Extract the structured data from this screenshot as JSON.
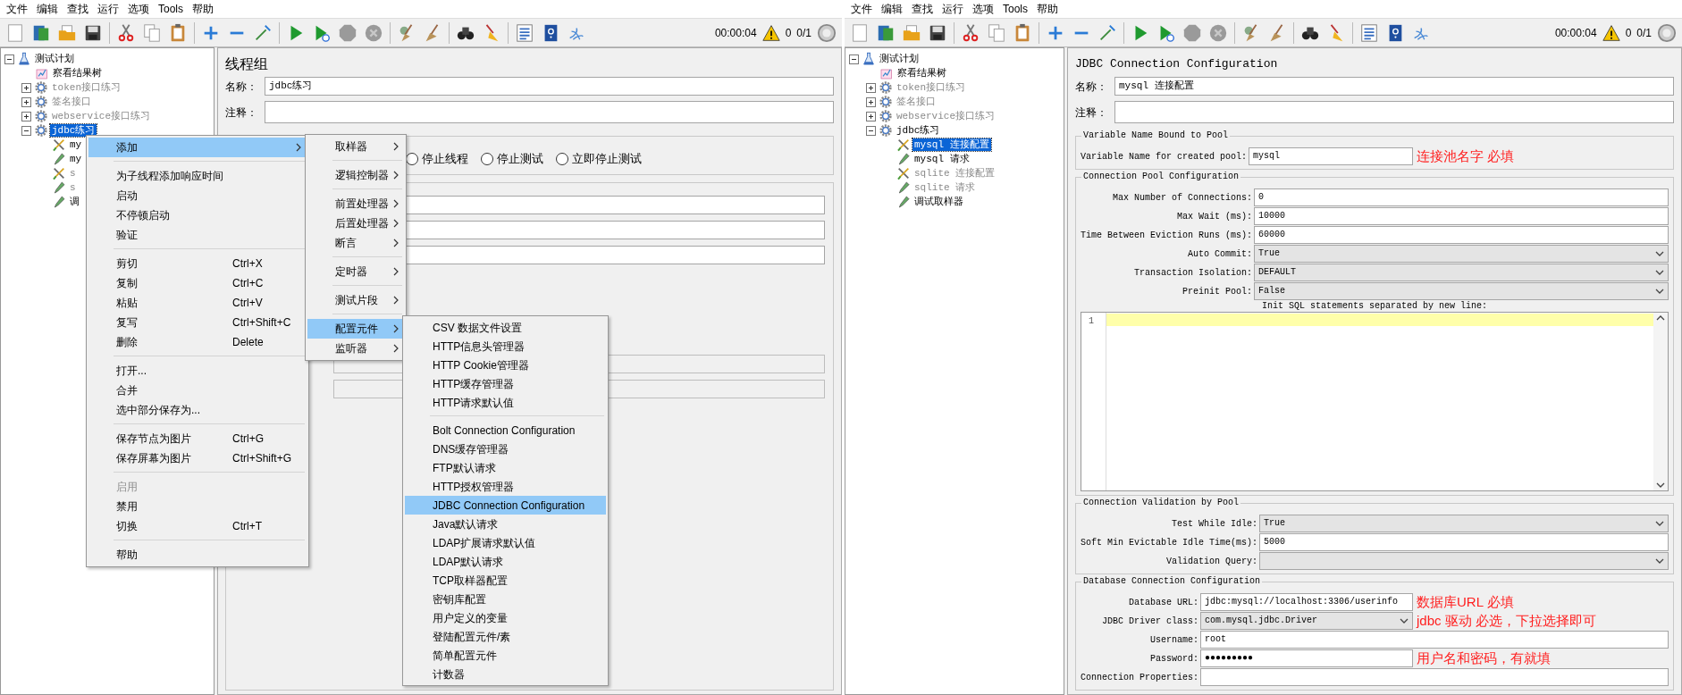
{
  "windows": [
    {
      "menubar": [
        "文件",
        "编辑",
        "查找",
        "运行",
        "选项",
        "Tools",
        "帮助"
      ],
      "status": {
        "timer": "00:00:04",
        "warnings": "0",
        "threads": "0/1"
      },
      "tree": [
        {
          "label": "测试计划",
          "kind": "plan",
          "expanded": true,
          "selected": false,
          "disabled": false,
          "children": [
            {
              "label": "察看结果树",
              "kind": "listener",
              "selected": false,
              "disabled": false
            },
            {
              "label": "token接口练习",
              "kind": "thread-group",
              "expanded": false,
              "selected": false,
              "disabled": true
            },
            {
              "label": "签名接口",
              "kind": "thread-group",
              "expanded": false,
              "selected": false,
              "disabled": true
            },
            {
              "label": "webservice接口练习",
              "kind": "thread-group",
              "expanded": false,
              "selected": false,
              "disabled": true
            },
            {
              "label": "jdbc练习",
              "kind": "thread-group",
              "expanded": true,
              "selected": true,
              "disabled": false,
              "children": [
                {
                  "label": "my",
                  "kind": "config",
                  "selected": false,
                  "disabled": false
                },
                {
                  "label": "my",
                  "kind": "sampler",
                  "selected": false,
                  "disabled": false
                },
                {
                  "label": "s",
                  "kind": "config",
                  "selected": false,
                  "disabled": true
                },
                {
                  "label": "s",
                  "kind": "sampler",
                  "selected": false,
                  "disabled": true
                },
                {
                  "label": "调",
                  "kind": "sampler",
                  "selected": false,
                  "disabled": false
                }
              ]
            }
          ]
        }
      ],
      "panel": {
        "kind": "thread-group",
        "title": "线程组",
        "name_label": "名称：",
        "name_value": "jdbc练习",
        "comment_label": "注释：",
        "radios": [
          {
            "label": "停止线程",
            "selected": false
          },
          {
            "label": "停止测试",
            "selected": false
          },
          {
            "label": "立即停止测试",
            "selected": false
          }
        ],
        "fields": [
          {
            "disabled": false
          },
          {
            "disabled": false
          },
          {
            "disabled": false
          },
          {
            "disabled": true
          },
          {
            "disabled": true
          }
        ]
      },
      "context_menu": {
        "groups": [
          [
            {
              "label": "添加",
              "has_submenu": true,
              "selected": true,
              "disabled": false,
              "submenu": {
                "groups": [
                  [
                    {
                      "label": "取样器",
                      "has_submenu": true,
                      "selected": false
                    }
                  ],
                  [
                    {
                      "label": "逻辑控制器",
                      "has_submenu": true,
                      "selected": false
                    }
                  ],
                  [
                    {
                      "label": "前置处理器",
                      "has_submenu": true,
                      "selected": false
                    },
                    {
                      "label": "后置处理器",
                      "has_submenu": true,
                      "selected": false
                    },
                    {
                      "label": "断言",
                      "has_submenu": true,
                      "selected": false
                    }
                  ],
                  [
                    {
                      "label": "定时器",
                      "has_submenu": true,
                      "selected": false
                    }
                  ],
                  [
                    {
                      "label": "测试片段",
                      "has_submenu": true,
                      "selected": false
                    }
                  ],
                  [
                    {
                      "label": "配置元件",
                      "has_submenu": true,
                      "selected": true,
                      "submenu": {
                        "groups": [
                          [
                            {
                              "label": "CSV 数据文件设置",
                              "selected": false
                            },
                            {
                              "label": "HTTP信息头管理器",
                              "selected": false
                            },
                            {
                              "label": "HTTP Cookie管理器",
                              "selected": false
                            },
                            {
                              "label": "HTTP缓存管理器",
                              "selected": false
                            },
                            {
                              "label": "HTTP请求默认值",
                              "selected": false
                            }
                          ],
                          [
                            {
                              "label": "Bolt Connection Configuration",
                              "selected": false
                            },
                            {
                              "label": "DNS缓存管理器",
                              "selected": false
                            },
                            {
                              "label": "FTP默认请求",
                              "selected": false
                            },
                            {
                              "label": "HTTP授权管理器",
                              "selected": false
                            },
                            {
                              "label": "JDBC Connection Configuration",
                              "selected": true
                            },
                            {
                              "label": "Java默认请求",
                              "selected": false
                            },
                            {
                              "label": "LDAP扩展请求默认值",
                              "selected": false
                            },
                            {
                              "label": "LDAP默认请求",
                              "selected": false
                            },
                            {
                              "label": "TCP取样器配置",
                              "selected": false
                            },
                            {
                              "label": "密钥库配置",
                              "selected": false
                            },
                            {
                              "label": "用户定义的变量",
                              "selected": false
                            },
                            {
                              "label": "登陆配置元件/素",
                              "selected": false
                            },
                            {
                              "label": "简单配置元件",
                              "selected": false
                            },
                            {
                              "label": "计数器",
                              "selected": false
                            }
                          ]
                        ]
                      }
                    },
                    {
                      "label": "监听器",
                      "has_submenu": true,
                      "selected": false
                    }
                  ]
                ]
              }
            }
          ],
          [
            {
              "label": "为子线程添加响应时间",
              "has_submenu": false,
              "selected": false,
              "disabled": false
            },
            {
              "label": "启动",
              "has_submenu": false,
              "selected": false,
              "disabled": false
            },
            {
              "label": "不停顿启动",
              "has_submenu": false,
              "selected": false,
              "disabled": false
            },
            {
              "label": "验证",
              "has_submenu": false,
              "selected": false,
              "disabled": false
            }
          ],
          [
            {
              "label": "剪切",
              "shortcut": "Ctrl+X",
              "has_submenu": false,
              "selected": false,
              "disabled": false
            },
            {
              "label": "复制",
              "shortcut": "Ctrl+C",
              "has_submenu": false,
              "selected": false,
              "disabled": false
            },
            {
              "label": "粘贴",
              "shortcut": "Ctrl+V",
              "has_submenu": false,
              "selected": false,
              "disabled": false
            },
            {
              "label": "复写",
              "shortcut": "Ctrl+Shift+C",
              "has_submenu": false,
              "selected": false,
              "disabled": false
            },
            {
              "label": "删除",
              "shortcut": "Delete",
              "has_submenu": false,
              "selected": false,
              "disabled": false
            }
          ],
          [
            {
              "label": "打开...",
              "has_submenu": false,
              "selected": false,
              "disabled": false
            },
            {
              "label": "合并",
              "has_submenu": false,
              "selected": false,
              "disabled": false
            },
            {
              "label": "选中部分保存为...",
              "has_submenu": false,
              "selected": false,
              "disabled": false
            }
          ],
          [
            {
              "label": "保存节点为图片",
              "shortcut": "Ctrl+G",
              "has_submenu": false,
              "selected": false,
              "disabled": false
            },
            {
              "label": "保存屏幕为图片",
              "shortcut": "Ctrl+Shift+G",
              "has_submenu": false,
              "selected": false,
              "disabled": false
            }
          ],
          [
            {
              "label": "启用",
              "has_submenu": false,
              "selected": false,
              "disabled": true
            },
            {
              "label": "禁用",
              "has_submenu": false,
              "selected": false,
              "disabled": false
            },
            {
              "label": "切换",
              "shortcut": "Ctrl+T",
              "has_submenu": false,
              "selected": false,
              "disabled": false
            }
          ],
          [
            {
              "label": "帮助",
              "has_submenu": false,
              "selected": false,
              "disabled": false
            }
          ]
        ]
      }
    },
    {
      "menubar": [
        "文件",
        "编辑",
        "查找",
        "运行",
        "选项",
        "Tools",
        "帮助"
      ],
      "status": {
        "timer": "00:00:04",
        "warnings": "0",
        "threads": "0/1"
      },
      "tree": [
        {
          "label": "测试计划",
          "kind": "plan",
          "expanded": true,
          "selected": false,
          "disabled": false,
          "children": [
            {
              "label": "察看结果树",
              "kind": "listener",
              "selected": false,
              "disabled": false
            },
            {
              "label": "token接口练习",
              "kind": "thread-group",
              "expanded": false,
              "selected": false,
              "disabled": true
            },
            {
              "label": "签名接口",
              "kind": "thread-group",
              "expanded": false,
              "selected": false,
              "disabled": true
            },
            {
              "label": "webservice接口练习",
              "kind": "thread-group",
              "expanded": false,
              "selected": false,
              "disabled": true
            },
            {
              "label": "jdbc练习",
              "kind": "thread-group",
              "expanded": true,
              "selected": false,
              "disabled": false,
              "children": [
                {
                  "label": "mysql 连接配置",
                  "kind": "config",
                  "selected": true,
                  "disabled": false
                },
                {
                  "label": "mysql 请求",
                  "kind": "sampler",
                  "selected": false,
                  "disabled": false
                },
                {
                  "label": "sqlite 连接配置",
                  "kind": "config",
                  "selected": false,
                  "disabled": true
                },
                {
                  "label": "sqlite 请求",
                  "kind": "sampler",
                  "selected": false,
                  "disabled": true
                },
                {
                  "label": "调试取样器",
                  "kind": "sampler",
                  "selected": false,
                  "disabled": false
                }
              ]
            }
          ]
        }
      ],
      "panel": {
        "kind": "jdbc-config",
        "title": "JDBC Connection Configuration",
        "name_label": "名称：",
        "name_value": "mysql 连接配置",
        "comment_label": "注释：",
        "sections": [
          {
            "legend": "Variable Name Bound to Pool",
            "rows": [
              {
                "label": "Variable Name for created pool:",
                "kind": "text",
                "value": "mysql",
                "note": "连接池名字 必填"
              }
            ]
          },
          {
            "legend": "Connection Pool Configuration",
            "rows": [
              {
                "label": "Max Number of Connections:",
                "kind": "text",
                "value": "0"
              },
              {
                "label": "Max Wait (ms):",
                "kind": "text",
                "value": "10000"
              },
              {
                "label": "Time Between Eviction Runs (ms):",
                "kind": "text",
                "value": "60000"
              },
              {
                "label": "Auto Commit:",
                "kind": "select",
                "value": "True"
              },
              {
                "label": "Transaction Isolation:",
                "kind": "select",
                "value": "DEFAULT"
              },
              {
                "label": "Preinit Pool:",
                "kind": "select",
                "value": "False"
              }
            ],
            "editor": {
              "label": "Init SQL statements separated by new line:",
              "line_number": "1"
            }
          },
          {
            "legend": "Connection Validation by Pool",
            "rows": [
              {
                "label": "Test While Idle:",
                "kind": "select",
                "value": "True"
              },
              {
                "label": "Soft Min Evictable Idle Time(ms):",
                "kind": "text",
                "value": "5000"
              },
              {
                "label": "Validation Query:",
                "kind": "select"
              }
            ]
          },
          {
            "legend": "Database Connection Configuration",
            "rows": [
              {
                "label": "Database URL:",
                "kind": "text",
                "value": "jdbc:mysql://localhost:3306/userinfo",
                "note": "数据库URL 必填"
              },
              {
                "label": "JDBC Driver class:",
                "kind": "select",
                "value": "com.mysql.jdbc.Driver",
                "note": "jdbc 驱动 必选，下拉选择即可"
              },
              {
                "label": "Username:",
                "kind": "text",
                "value": "root"
              },
              {
                "label": "Password:",
                "kind": "password",
                "value": "●●●●●●●●●",
                "note": "用户名和密码，有就填"
              },
              {
                "label": "Connection Properties:",
                "kind": "text"
              }
            ]
          }
        ]
      }
    }
  ]
}
